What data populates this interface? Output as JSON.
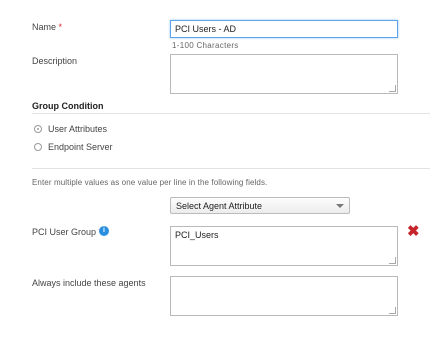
{
  "form": {
    "name_label": "Name",
    "required_marker": "*",
    "name_value": "PCI Users - AD",
    "name_hint": "1-100 Characters",
    "description_label": "Description",
    "description_value": ""
  },
  "group_condition": {
    "title": "Group Condition",
    "options": [
      {
        "label": "User Attributes",
        "selected": true
      },
      {
        "label": "Endpoint Server",
        "selected": false
      }
    ]
  },
  "instructions": "Enter multiple values as one value per line in the following fields.",
  "attribute_select": {
    "selected": "Select Agent Attribute"
  },
  "pci_user_group": {
    "label": "PCI User Group",
    "required_marker": "*",
    "info_icon": "info-icon",
    "value": "PCI_Users",
    "remove_icon": "close-x-icon"
  },
  "always_include": {
    "label": "Always include these agents",
    "value": ""
  }
}
